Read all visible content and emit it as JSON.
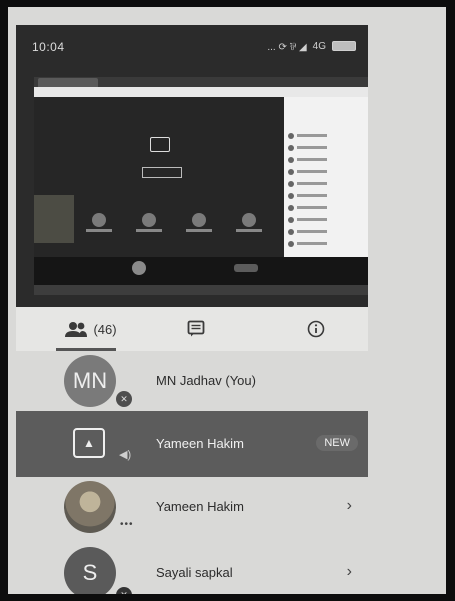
{
  "status_bar": {
    "time": "10:04",
    "network": "4G",
    "indicators": "... ⟳ ⅌ ◢"
  },
  "tabs": {
    "participants_count": "(46)",
    "icons": [
      "people-icon",
      "chat-icon",
      "info-icon"
    ]
  },
  "participants": [
    {
      "initials": "MN",
      "name": "MN Jadhav (You)",
      "badge": "",
      "avatar_color": "#7a7a7a"
    },
    {
      "name": "Yameen Hakim",
      "badge": "NEW"
    },
    {
      "name": "Yameen Hakim"
    },
    {
      "initials": "S",
      "name": "Sayali sapkal",
      "avatar_color": "#5a5a5a"
    }
  ]
}
